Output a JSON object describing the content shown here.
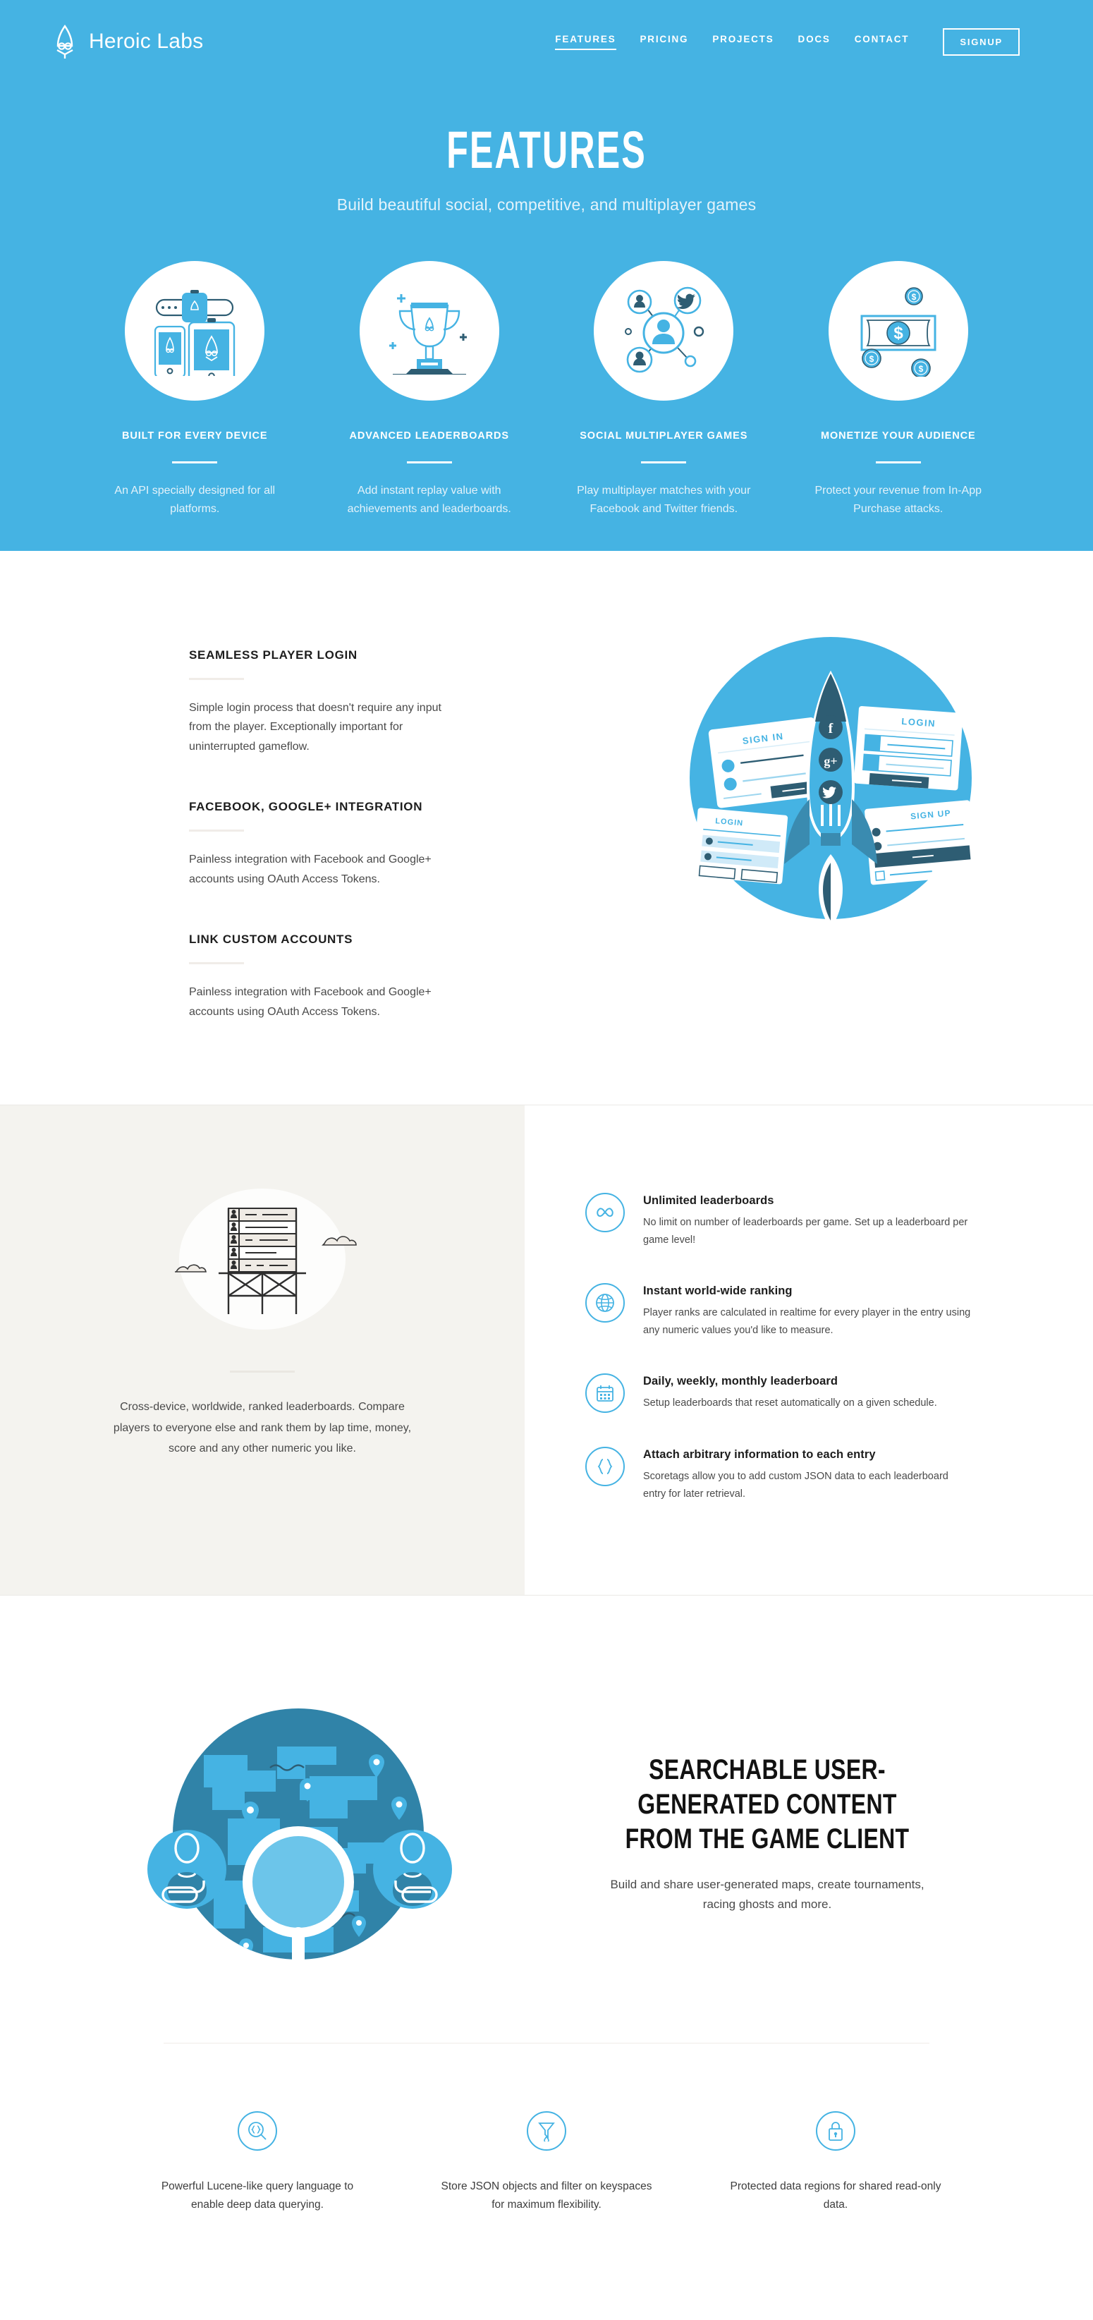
{
  "brand": {
    "name": "Heroic Labs",
    "logo_icon": "rocket-logo-icon"
  },
  "nav": {
    "links": [
      {
        "label": "FEATURES",
        "active": true
      },
      {
        "label": "PRICING",
        "active": false
      },
      {
        "label": "PROJECTS",
        "active": false
      },
      {
        "label": "DOCS",
        "active": false
      },
      {
        "label": "CONTACT",
        "active": false
      }
    ],
    "signup_label": "SIGNUP"
  },
  "hero": {
    "title": "FEATURES",
    "subtitle": "Build beautiful social, competitive, and multiplayer games",
    "cards": [
      {
        "icon": "devices-icon",
        "title": "BUILT FOR EVERY DEVICE",
        "desc": "An API specially designed for all platforms."
      },
      {
        "icon": "trophy-icon",
        "title": "ADVANCED LEADERBOARDS",
        "desc": "Add instant replay value with achievements and leaderboards."
      },
      {
        "icon": "social-network-icon",
        "title": "SOCIAL MULTIPLAYER GAMES",
        "desc": "Play multiplayer matches with your Facebook and Twitter friends."
      },
      {
        "icon": "banknote-icon",
        "title": "MONETIZE YOUR AUDIENCE",
        "desc": "Protect your revenue from In-App Purchase attacks."
      }
    ]
  },
  "login_section": {
    "illustration": "rocket-login-illustration",
    "groups": [
      {
        "title": "SEAMLESS PLAYER LOGIN",
        "desc": "Simple login process that doesn't require any input from the player. Exceptionally important for uninterrupted gameflow."
      },
      {
        "title": "FACEBOOK, GOOGLE+ INTEGRATION",
        "desc": "Painless integration with Facebook and Google+ accounts using OAuth Access Tokens."
      },
      {
        "title": "LINK CUSTOM ACCOUNTS",
        "desc": "Painless integration with Facebook and Google+ accounts using OAuth Access Tokens."
      }
    ],
    "rocket_social_icons": [
      "facebook-icon",
      "google-plus-icon",
      "twitter-icon"
    ],
    "cards": [
      "SIGN IN",
      "LOGIN",
      "LOGIN",
      "SIGN UP"
    ]
  },
  "leaderboard_section": {
    "illustration": "leaderboard-tower-illustration",
    "caption": "Cross-device, worldwide, ranked leaderboards. Compare players to everyone else and rank them by lap time, money, score and any other numeric you like.",
    "items": [
      {
        "icon": "infinity-icon",
        "title": "Unlimited leaderboards",
        "desc": "No limit on number of leaderboards per game. Set up a leaderboard per game level!"
      },
      {
        "icon": "globe-icon",
        "title": "Instant world-wide ranking",
        "desc": "Player ranks are calculated in realtime for every player in the entry using any numeric values you'd like to measure."
      },
      {
        "icon": "calendar-icon",
        "title": "Daily, weekly, monthly leaderboard",
        "desc": "Setup leaderboards that reset automatically on a given schedule."
      },
      {
        "icon": "braces-icon",
        "title": "Attach arbitrary information to each entry",
        "desc": "Scoretags allow you to add custom JSON data to each leaderboard entry for later retrieval."
      }
    ]
  },
  "search_section": {
    "illustration": "globe-magnifier-illustration",
    "title": "SEARCHABLE USER-GENERATED CONTENT FROM THE GAME CLIENT",
    "subtitle": "Build and share user-generated maps, create tournaments, racing ghosts and more."
  },
  "bottom_section": {
    "items": [
      {
        "icon": "query-magnifier-icon",
        "desc": "Powerful Lucene-like query language to enable deep data querying."
      },
      {
        "icon": "filter-funnel-icon",
        "desc": "Store JSON objects and filter on keyspaces for maximum flexibility."
      },
      {
        "icon": "lock-icon",
        "desc": "Protected data regions for shared read-only data."
      }
    ]
  },
  "colors": {
    "brand_blue": "#45b3e3",
    "deep_blue": "#3083a8",
    "dark_navy": "#2e5d73",
    "beige": "#f4f3ef",
    "text_dark": "#1d1d1d"
  }
}
